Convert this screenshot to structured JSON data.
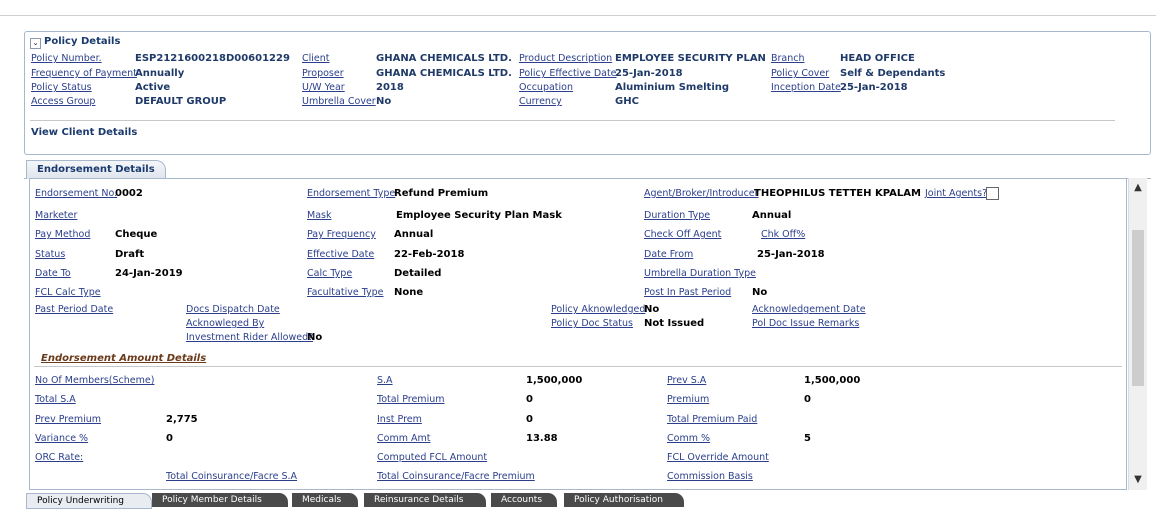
{
  "policy": {
    "title": "Policy Details",
    "fields": [
      {
        "label": "Policy Number.",
        "value": "ESP2121600218D00601229"
      },
      {
        "label": "Frequency of Payment",
        "value": "Annually"
      },
      {
        "label": "Policy Status",
        "value": "Active"
      },
      {
        "label": "Access Group",
        "value": "DEFAULT GROUP"
      },
      {
        "label": "Client",
        "value": "GHANA CHEMICALS LTD."
      },
      {
        "label": "Proposer",
        "value": "GHANA CHEMICALS LTD."
      },
      {
        "label": "U/W Year",
        "value": "2018"
      },
      {
        "label": "Umbrella Cover",
        "value": "No"
      },
      {
        "label": "Product Description",
        "value": "EMPLOYEE SECURITY PLAN"
      },
      {
        "label": "Policy Effective Date",
        "value": "25-Jan-2018"
      },
      {
        "label": "Occupation",
        "value": "Aluminium Smelting"
      },
      {
        "label": "Currency",
        "value": "GHC"
      },
      {
        "label": "Branch",
        "value": "HEAD OFFICE"
      },
      {
        "label": "Policy Cover",
        "value": "Self & Dependants"
      },
      {
        "label": "Inception Date",
        "value": "25-Jan-2018"
      }
    ],
    "view_client": "View Client Details"
  },
  "endorsement": {
    "tab": "Endorsement Details",
    "fields": [
      {
        "label": "Endorsement No.",
        "value": "0002"
      },
      {
        "label": "Endorsement Type",
        "value": "Refund Premium"
      },
      {
        "label": "Agent/Broker/Introducer",
        "value": "THEOPHILUS TETTEH KPALAM"
      },
      {
        "label": "Joint Agents?",
        "value": ""
      },
      {
        "label": "Marketer",
        "value": ""
      },
      {
        "label": "Mask",
        "value": "Employee Security Plan Mask"
      },
      {
        "label": "Duration Type",
        "value": "Annual"
      },
      {
        "label": "Pay Method",
        "value": "Cheque"
      },
      {
        "label": "Pay Frequency",
        "value": "Annual"
      },
      {
        "label": "Check Off Agent",
        "value": ""
      },
      {
        "label": "Chk Off%",
        "value": ""
      },
      {
        "label": "Status",
        "value": "Draft"
      },
      {
        "label": "Effective Date",
        "value": "22-Feb-2018"
      },
      {
        "label": "Date From",
        "value": "25-Jan-2018"
      },
      {
        "label": "Date To",
        "value": "24-Jan-2019"
      },
      {
        "label": "Calc Type",
        "value": "Detailed"
      },
      {
        "label": "Umbrella Duration Type",
        "value": ""
      },
      {
        "label": "FCL Calc Type",
        "value": ""
      },
      {
        "label": "Facultative Type",
        "value": "None"
      },
      {
        "label": "Post In Past Period",
        "value": "No"
      },
      {
        "label": "Past Period Date",
        "value": ""
      },
      {
        "label": "Docs Dispatch Date",
        "value": ""
      },
      {
        "label": "Policy Aknowledged",
        "value": "No"
      },
      {
        "label": "Acknowledgement Date",
        "value": ""
      },
      {
        "label": "Acknowleged By",
        "value": ""
      },
      {
        "label": "Policy Doc Status",
        "value": "Not Issued"
      },
      {
        "label": "Pol Doc Issue Remarks",
        "value": ""
      },
      {
        "label": "Investment Rider Allowed?",
        "value": "No"
      }
    ],
    "amount_title": "Endorsement Amount Details",
    "amounts": [
      {
        "label": "No Of Members(Scheme)",
        "value": ""
      },
      {
        "label": "S.A",
        "value": "1,500,000"
      },
      {
        "label": "Prev S.A",
        "value": "1,500,000"
      },
      {
        "label": "Total S.A",
        "value": ""
      },
      {
        "label": "Total Premium",
        "value": "0"
      },
      {
        "label": "Premium",
        "value": "0"
      },
      {
        "label": "Prev Premium",
        "value": "2,775"
      },
      {
        "label": "Inst Prem",
        "value": "0"
      },
      {
        "label": "Total Premium Paid",
        "value": ""
      },
      {
        "label": "Variance %",
        "value": "0"
      },
      {
        "label": "Comm Amt",
        "value": "13.88"
      },
      {
        "label": "Comm %",
        "value": "5"
      },
      {
        "label": "ORC Rate:",
        "value": ""
      },
      {
        "label": "Computed FCL Amount",
        "value": ""
      },
      {
        "label": "FCL Override Amount",
        "value": ""
      },
      {
        "label": "Total Coinsurance/Facre S.A",
        "value": ""
      },
      {
        "label": "Total Coinsurance/Facre Premium",
        "value": ""
      },
      {
        "label": "Commission Basis",
        "value": ""
      }
    ]
  },
  "bottom_tabs": [
    "Policy Underwriting",
    "Policy Member Details",
    "Medicals",
    "Reinsurance Details",
    "Accounts",
    "Policy Authorisation"
  ],
  "icons": {
    "collapse": "chevron-down-icon",
    "scroll_up": "arrow-up-icon",
    "scroll_down": "arrow-down-icon"
  }
}
